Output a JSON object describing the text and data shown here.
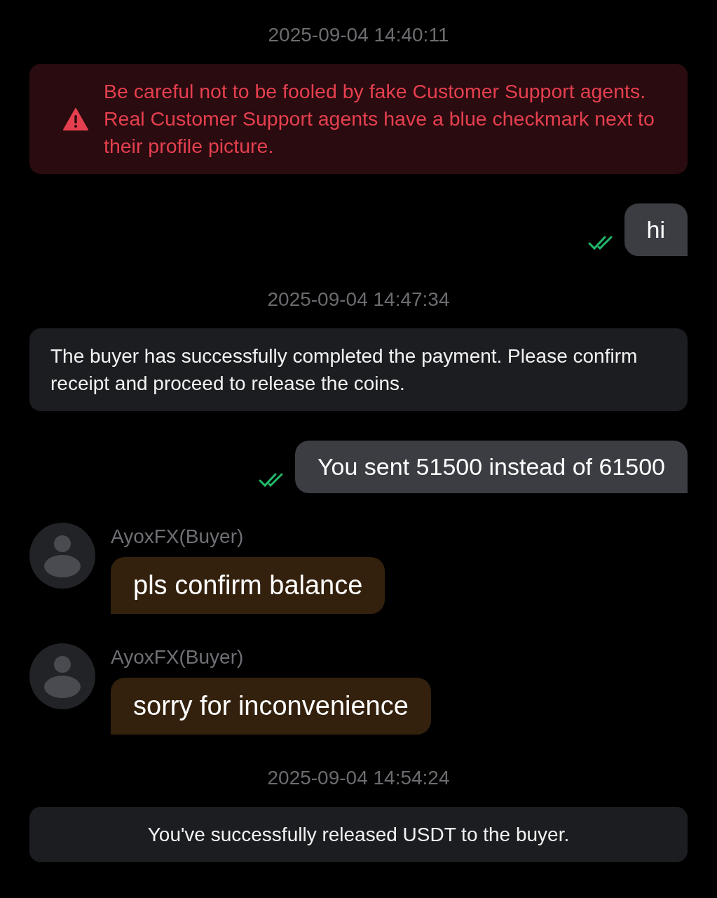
{
  "messages": [
    {
      "kind": "timestamp",
      "text": "2025-09-04 14:40:11"
    },
    {
      "kind": "warning",
      "text": "Be careful not to be fooled by fake Customer Support agents. Real Customer Support agents have a blue checkmark next to their profile picture."
    },
    {
      "kind": "outgoing",
      "text": "hi",
      "read": true
    },
    {
      "kind": "timestamp",
      "text": "2025-09-04 14:47:34"
    },
    {
      "kind": "system",
      "text": "The buyer has successfully completed the payment. Please confirm receipt and proceed to release the coins."
    },
    {
      "kind": "outgoing",
      "text": "You sent 51500 instead of 61500",
      "read": true
    },
    {
      "kind": "incoming",
      "sender": "AyoxFX(Buyer)",
      "text": "pls confirm balance"
    },
    {
      "kind": "incoming",
      "sender": "AyoxFX(Buyer)",
      "text": "sorry for inconvenience"
    },
    {
      "kind": "timestamp",
      "text": "2025-09-04 14:54:24"
    },
    {
      "kind": "notice",
      "text": "You've successfully released USDT to the buyer."
    }
  ]
}
